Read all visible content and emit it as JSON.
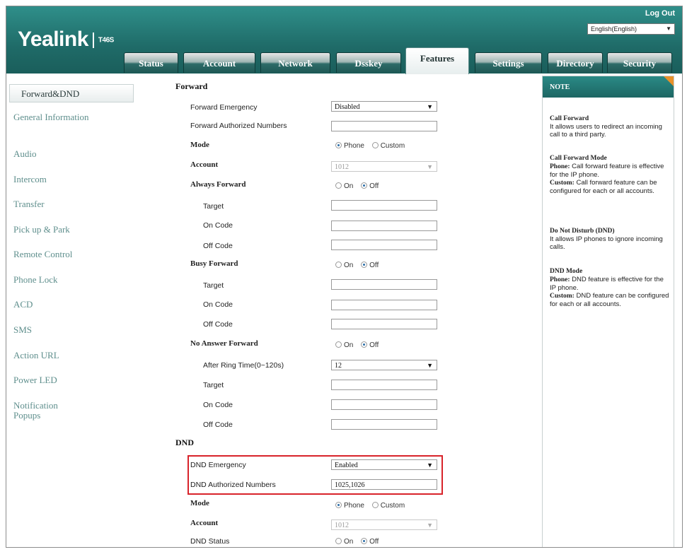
{
  "header": {
    "logo": "Yealink",
    "model": "T46S",
    "logout": "Log Out",
    "language": "English(English)"
  },
  "tabs": [
    "Status",
    "Account",
    "Network",
    "Dsskey",
    "Features",
    "Settings",
    "Directory",
    "Security"
  ],
  "active_tab": "Features",
  "sidebar": [
    "Forward&DND",
    "General Information",
    "Audio",
    "Intercom",
    "Transfer",
    "Pick up & Park",
    "Remote Control",
    "Phone Lock",
    "ACD",
    "SMS",
    "Action URL",
    "Power LED",
    "Notification Popups"
  ],
  "forward": {
    "title": "Forward",
    "emergency_label": "Forward Emergency",
    "emergency_value": "Disabled",
    "authorized_label": "Forward Authorized Numbers",
    "authorized_value": "",
    "mode_label": "Mode",
    "mode_phone": "Phone",
    "mode_custom": "Custom",
    "account_label": "Account",
    "account_value": "1012",
    "always_label": "Always Forward",
    "busy_label": "Busy Forward",
    "noanswer_label": "No Answer Forward",
    "on": "On",
    "off": "Off",
    "target_label": "Target",
    "oncode_label": "On Code",
    "offcode_label": "Off Code",
    "ring_time_label": "After Ring Time(0~120s)",
    "ring_time_value": "12"
  },
  "dnd": {
    "title": "DND",
    "emergency_label": "DND Emergency",
    "emergency_value": "Enabled",
    "authorized_label": "DND Authorized Numbers",
    "authorized_value": "1025,1026",
    "mode_label": "Mode",
    "mode_phone": "Phone",
    "mode_custom": "Custom",
    "account_label": "Account",
    "account_value": "1012",
    "status_label": "DND Status",
    "on": "On",
    "off": "Off"
  },
  "note": {
    "title": "NOTE",
    "cf_title": "Call Forward",
    "cf_text": "It allows users to redirect an incoming call to a third party.",
    "cfm_title": "Call Forward Mode",
    "cfm_phone": "Phone:",
    "cfm_phone_text": " Call forward feature is effective for the IP phone.",
    "cfm_custom": "Custom:",
    "cfm_custom_text": " Call forward feature can be configured for each or all accounts.",
    "dnd_title": "Do Not Disturb (DND)",
    "dnd_text": "It allows IP phones to ignore incoming calls.",
    "dndm_title": "DND Mode",
    "dndm_phone": "Phone:",
    "dndm_phone_text": " DND feature is effective for the IP phone.",
    "dndm_custom": "Custom:",
    "dndm_custom_text": " DND feature can be configured for each or all accounts."
  },
  "colors": {
    "header_teal": "#1f6b68",
    "highlight_red": "#d8232a",
    "note_corner": "#e8912a"
  }
}
